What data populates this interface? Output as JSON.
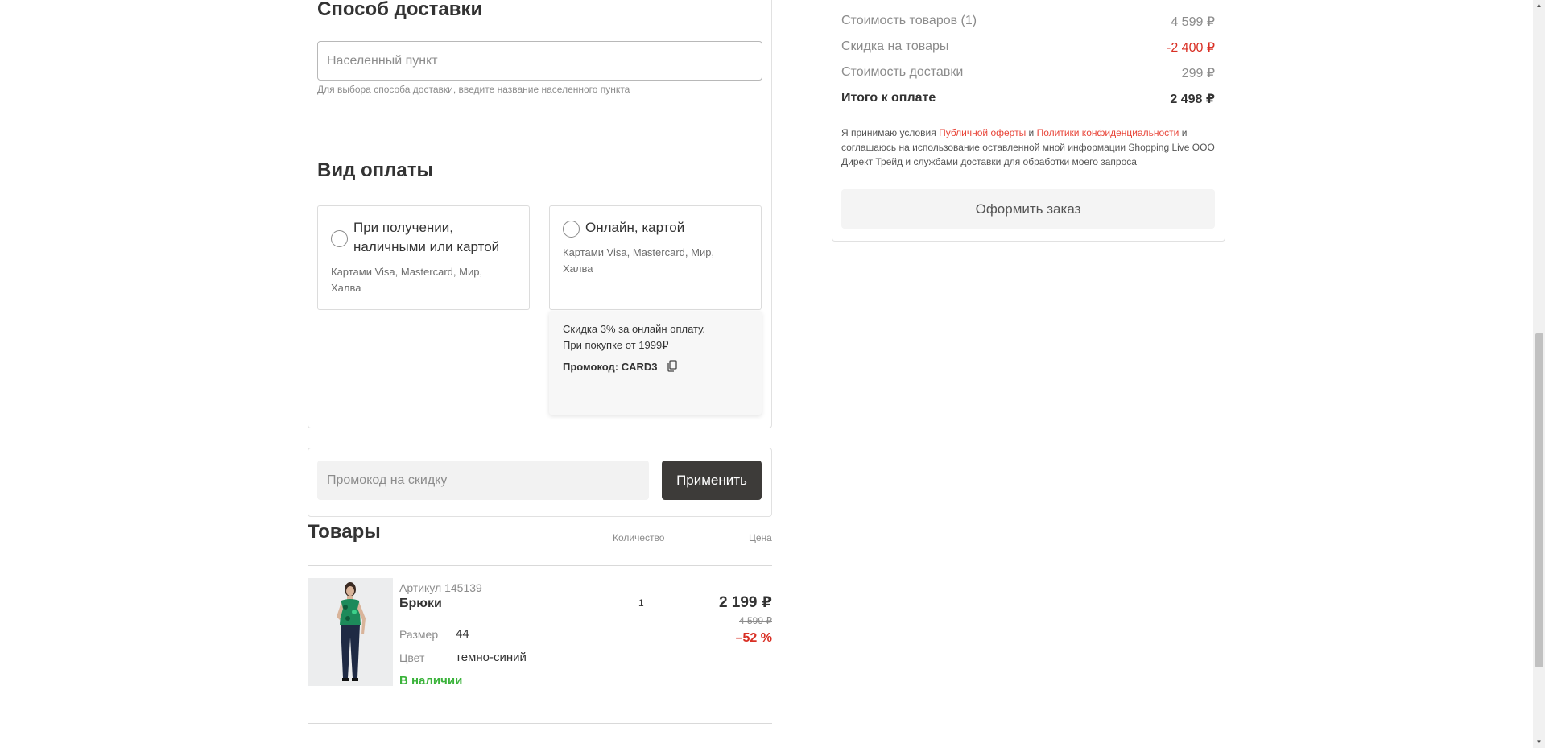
{
  "delivery": {
    "title": "Способ доставки",
    "city_placeholder": "Населенный пункт",
    "hint": "Для выбора способа доставки, введите название населенного пункта"
  },
  "payment": {
    "title": "Вид оплаты",
    "options": [
      {
        "title_line1": "При получении,",
        "title_line2": "наличными или картой",
        "sub_line1": "Картами Visa, Mastercard, Мир,",
        "sub_line2": "Халва"
      },
      {
        "title_line1": "Онлайн, картой",
        "sub_line1": "Картами Visa, Mastercard, Мир,",
        "sub_line2": "Халва"
      }
    ],
    "popup": {
      "line1": "Скидка 3% за онлайн оплату.",
      "line2": "При покупке от 1999₽",
      "promo": "Промокод: CARD3"
    }
  },
  "promo": {
    "placeholder": "Промокод на скидку",
    "apply_label": "Применить"
  },
  "goods": {
    "title": "Товары",
    "col_qty": "Количество",
    "col_price": "Цена",
    "items": [
      {
        "article": "Артикул 145139",
        "name": "Брюки",
        "size_label": "Размер",
        "size": "44",
        "color_label": "Цвет",
        "color": "темно-синий",
        "stock": "В наличии",
        "qty": "1",
        "price": "2 199 ₽",
        "old_price": "4 599 ₽",
        "discount": "–52 %"
      }
    ]
  },
  "summary": {
    "rows": [
      {
        "label": "Стоимость товаров (1)",
        "value": "4 599 ₽"
      },
      {
        "label": "Скидка на товары",
        "value": "-2 400 ₽"
      },
      {
        "label": "Стоимость доставки",
        "value": "299 ₽"
      }
    ],
    "total_label": "Итого к оплате",
    "total_value": "2 498 ₽",
    "agree_1": "Я принимаю условия ",
    "agree_link1": "Публичной оферты",
    "agree_2": " и ",
    "agree_link2": "Политики конфиденциальности",
    "agree_3": " и соглашаюсь на использование оставленной мной информации Shopping Live ООО Директ Трейд и службами доставки для обработки моего запроса",
    "order_label": "Оформить заказ"
  },
  "colors": {
    "accent_dark": "#3d3b39",
    "discount_red": "#d93025",
    "link_red": "#e8463a",
    "stock_green": "#3bb33b"
  }
}
